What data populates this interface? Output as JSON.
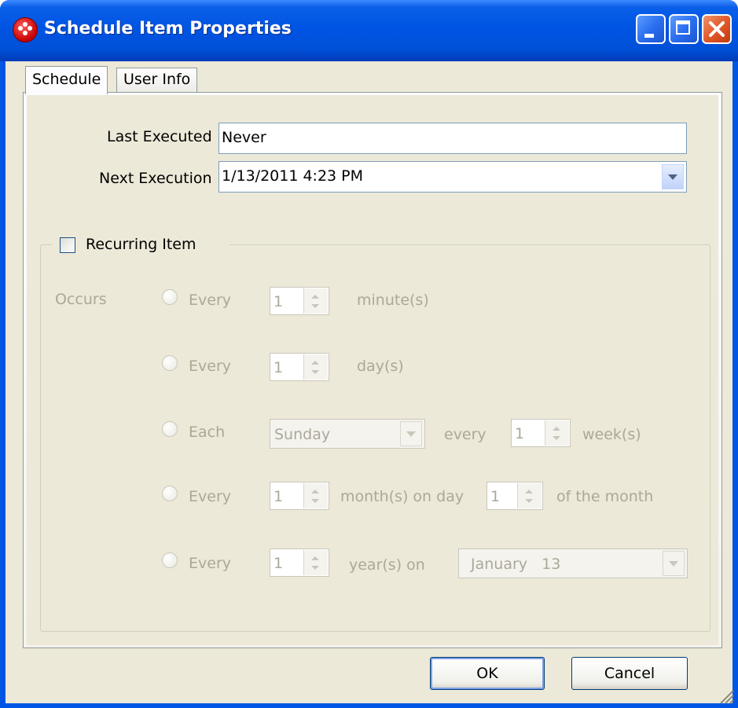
{
  "window": {
    "title": "Schedule Item Properties",
    "controls": [
      "minimize-icon",
      "maximize-icon",
      "close-icon"
    ]
  },
  "tabs": [
    {
      "label": "Schedule",
      "active": true
    },
    {
      "label": "User Info",
      "active": false
    }
  ],
  "schedule": {
    "last_executed_label": "Last Executed",
    "last_executed_value": "Never",
    "next_execution_label": "Next Execution",
    "next_execution_value": "1/13/2011 4:23 PM"
  },
  "recurring": {
    "checkbox_label": "Recurring Item",
    "checked": false,
    "occurs_label": "Occurs",
    "rows": {
      "minutes": {
        "radio_label": "Every",
        "spin_value": "1",
        "suffix": "minute(s)"
      },
      "days": {
        "radio_label": "Every",
        "spin_value": "1",
        "suffix": "day(s)"
      },
      "weeks": {
        "radio_label": "Each",
        "combo_value": "Sunday",
        "middle": "every",
        "spin_value": "1",
        "suffix": "week(s)"
      },
      "months": {
        "radio_label": "Every",
        "spin_value": "1",
        "middle": "month(s) on day",
        "day_value": "1",
        "suffix": "of the month"
      },
      "years": {
        "radio_label": "Every",
        "spin_value": "1",
        "middle": "year(s) on",
        "combo_value": "January   13"
      }
    }
  },
  "buttons": {
    "ok": "OK",
    "cancel": "Cancel"
  },
  "colors": {
    "titlebar": "#0054e3",
    "dialog_bg": "#ece9d8",
    "disabled_text": "#aca899"
  }
}
